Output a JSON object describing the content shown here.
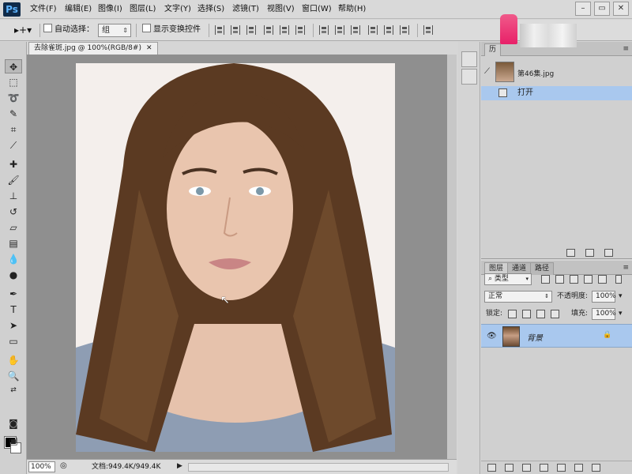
{
  "app": {
    "logo": "Ps"
  },
  "menu": [
    "文件(F)",
    "编辑(E)",
    "图像(I)",
    "图层(L)",
    "文字(Y)",
    "选择(S)",
    "滤镜(T)",
    "视图(V)",
    "窗口(W)",
    "帮助(H)"
  ],
  "window_controls": [
    "–",
    "▭",
    "✕"
  ],
  "options_bar": {
    "auto_select_label": "自动选择：",
    "auto_select_value": "组",
    "show_transform_label": "显示变换控件"
  },
  "document": {
    "tab_title": "去除雀斑.jpg @ 100%(RGB/8#)",
    "zoom": "100%",
    "doc_info": "文档:949.4K/949.4K"
  },
  "history_panel": {
    "tab": "历",
    "snapshot_label": "第46集.jpg",
    "rows": [
      {
        "label": "打开"
      }
    ]
  },
  "layers_panel": {
    "tabs": [
      "图层",
      "通道",
      "路径"
    ],
    "filter_kind": "类型",
    "blend_mode": "正常",
    "opacity_label": "不透明度:",
    "opacity_value": "100%",
    "lock_label": "锁定:",
    "fill_label": "填充:",
    "fill_value": "100%",
    "layers": [
      {
        "name": "背景",
        "locked": true,
        "visible": true
      }
    ]
  }
}
